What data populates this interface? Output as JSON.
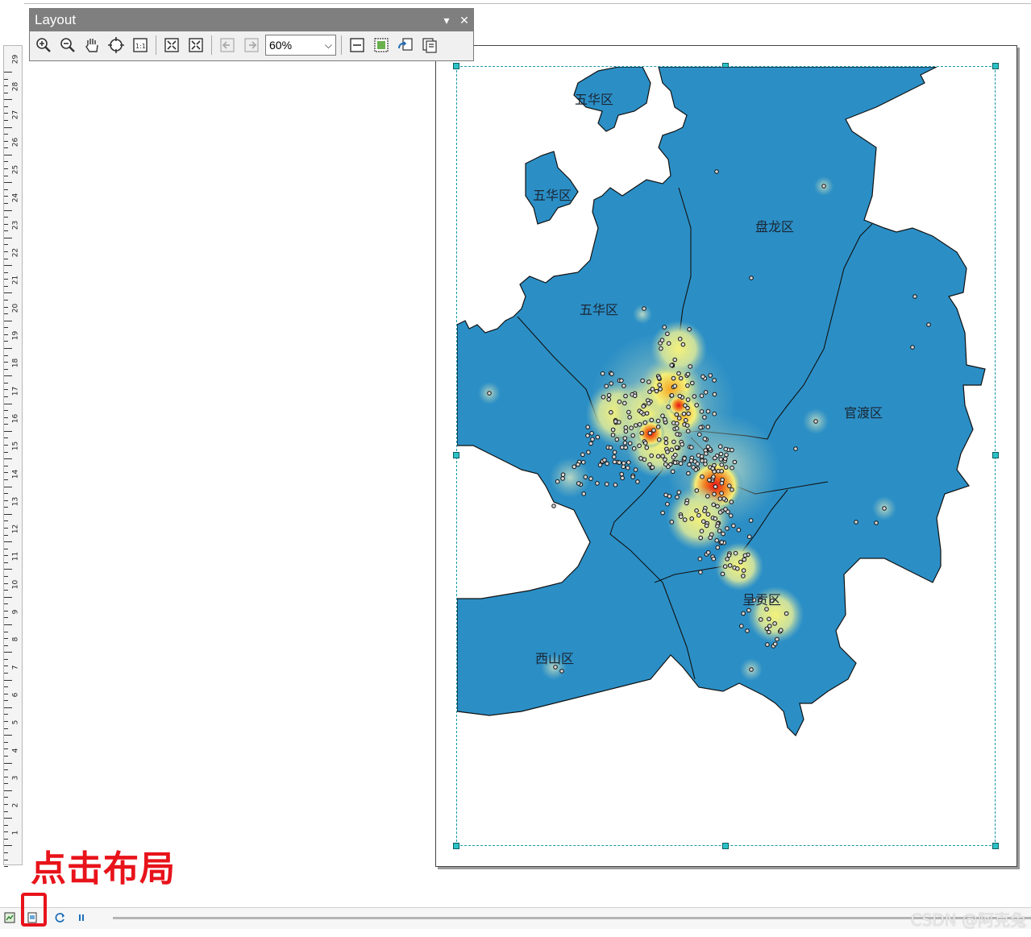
{
  "toolbar": {
    "title": "Layout",
    "zoom_value": "60%",
    "tools": [
      "zoom-in-icon",
      "zoom-out-icon",
      "pan-hand-icon",
      "full-extent-icon",
      "zoom-100-icon",
      "fixed-zoom-in-icon",
      "fixed-zoom-out-icon",
      "back-extent-icon",
      "forward-extent-icon",
      "toggle-draft-icon",
      "focus-data-frame-icon",
      "change-layout-icon",
      "data-driven-pages-icon"
    ]
  },
  "ruler": {
    "ticks": [
      "29",
      "28",
      "27",
      "26",
      "25",
      "24",
      "23",
      "22",
      "21",
      "20",
      "19",
      "18",
      "17",
      "16",
      "15",
      "14",
      "13",
      "12",
      "11",
      "10",
      "9",
      "8",
      "7",
      "6",
      "5",
      "4",
      "3",
      "2",
      "1"
    ]
  },
  "map": {
    "labels": [
      {
        "name": "label-wuhua-1",
        "text": "五华区"
      },
      {
        "name": "label-wuhua-2",
        "text": "五华区"
      },
      {
        "name": "label-panlong",
        "text": "盘龙区"
      },
      {
        "name": "label-wuhua-3",
        "text": "五华区"
      },
      {
        "name": "label-guandu",
        "text": "官渡区"
      },
      {
        "name": "label-chenggong",
        "text": "呈贡区"
      },
      {
        "name": "label-xishan",
        "text": "西山区"
      }
    ],
    "colors": {
      "land": "#2b8fc6",
      "water": "#ffffff",
      "hot": "#e8121a",
      "warm": "#f5a623",
      "mild": "#f4f17a",
      "halo": "#8fc0b9"
    }
  },
  "annotation": {
    "text": "点击布局"
  },
  "watermark": {
    "text": "CSDN @阿克兔"
  }
}
